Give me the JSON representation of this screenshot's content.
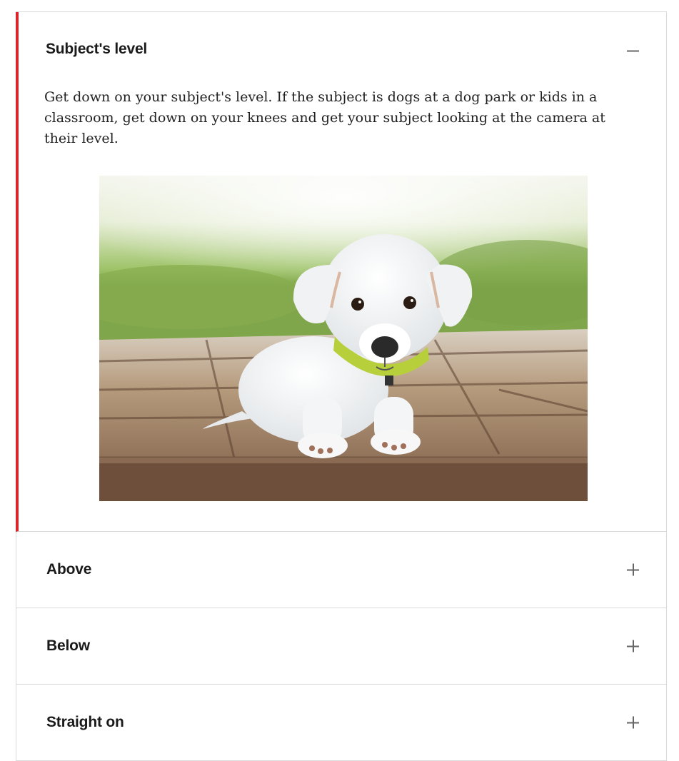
{
  "accordion": {
    "panels": [
      {
        "title": "Subject's level",
        "state": "expanded",
        "icon": "minus-icon",
        "text": "Get down on your subject's level. If the subject is dogs at a dog park or kids in a classroom, get down on your knees and get your subject looking at the camera at their level.",
        "image": "white-puppy-on-wooden-deck-photo"
      },
      {
        "title": "Above",
        "state": "collapsed",
        "icon": "plus-icon"
      },
      {
        "title": "Below",
        "state": "collapsed",
        "icon": "plus-icon"
      },
      {
        "title": "Straight on",
        "state": "collapsed",
        "icon": "plus-icon"
      }
    ]
  },
  "colors": {
    "accent": "#d7262c",
    "border": "#d9d9d9",
    "icon": "#666666"
  }
}
